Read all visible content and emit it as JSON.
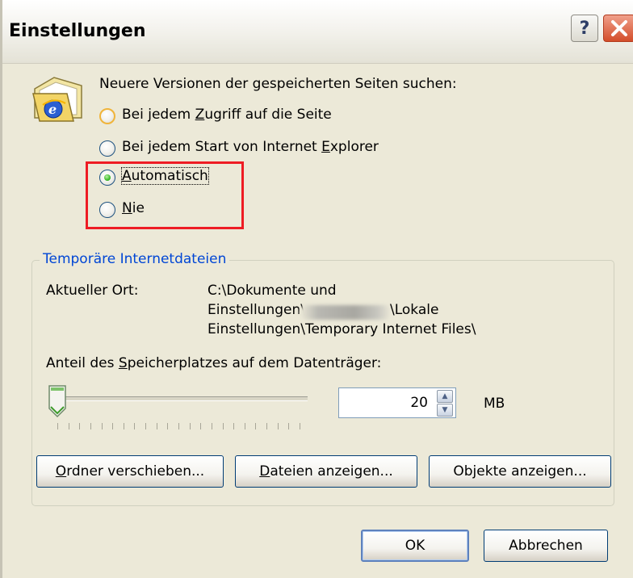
{
  "window": {
    "title": "Einstellungen",
    "help_glyph": "?",
    "close_glyph": "✕"
  },
  "icons": {
    "folder": "folder-ie-icon",
    "help": "help-icon",
    "close": "close-icon",
    "spin_up": "spin-up-arrow",
    "spin_down": "spin-down-arrow"
  },
  "check_versions": {
    "label": "Neuere Versionen der gespeicherten Seiten suchen:",
    "options": [
      {
        "pre": "Bei jedem ",
        "key": "Z",
        "post": "ugriff auf die Seite",
        "selected": false
      },
      {
        "pre": "Bei jedem Start von Internet ",
        "key": "E",
        "post": "xplorer",
        "selected": false
      },
      {
        "pre": "",
        "key": "A",
        "post": "utomatisch",
        "selected": true
      },
      {
        "pre": "",
        "key": "N",
        "post": "ie",
        "selected": false
      }
    ],
    "highlight_color": "#ee1c24"
  },
  "temp_files": {
    "group_title": "Temporäre Internetdateien",
    "location_label": "Aktueller Ort:",
    "location_line1": "C:\\Dokumente und",
    "location_line2_a": "Einstellungen\\",
    "location_line2_b": "\\Lokale",
    "location_line3": "Einstellungen\\Temporary Internet Files\\",
    "space_label_pre": "Anteil des ",
    "space_label_key": "S",
    "space_label_post": "peicherplatzes auf dem Datenträger:",
    "slider_fraction": 0.0,
    "space_value": "20",
    "space_unit": "MB",
    "buttons": [
      {
        "pre": "",
        "key": "O",
        "post": "rdner verschieben..."
      },
      {
        "pre": "",
        "key": "D",
        "post": "ateien anzeigen..."
      },
      {
        "pre": "Ob",
        "key": "j",
        "post": "ekte anzeigen..."
      }
    ]
  },
  "footer": {
    "ok_label": "OK",
    "cancel_label": "Abbrechen"
  },
  "colors": {
    "dialog_bg": "#ece9d8",
    "group_title": "#0046d5",
    "button_border": "#003c74"
  }
}
